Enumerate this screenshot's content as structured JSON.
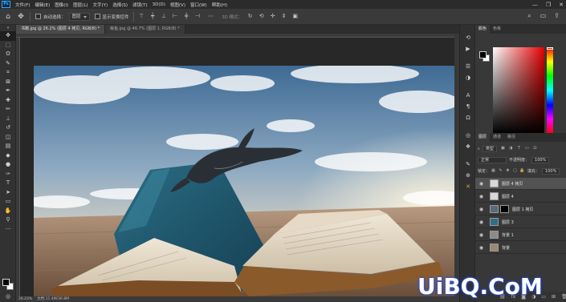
{
  "app": {
    "logo": "Ps"
  },
  "menu": [
    "文件(F)",
    "编辑(E)",
    "图像(I)",
    "图层(L)",
    "文字(Y)",
    "选择(S)",
    "滤镜(T)",
    "3D(D)",
    "视图(V)",
    "窗口(W)",
    "帮助(H)"
  ],
  "window_controls": [
    "—",
    "❐",
    "✕"
  ],
  "options": {
    "auto_select_label": "自动选择：",
    "auto_select_value": "图层",
    "transform_label": "显示变换控件",
    "mode_3d": "3D 模式："
  },
  "tabs": [
    {
      "label": "书籍.jpg @ 26.2% (图层 4 拷贝, RGB/8) *",
      "active": true
    },
    {
      "label": "鲸鱼.jpg @ 46.7% (图层 1, RGB/8) *",
      "active": false
    }
  ],
  "status": {
    "zoom": "26.23%",
    "doc": "文档:11.4M/36.8M"
  },
  "color_panel": {
    "tabs": [
      "颜色",
      "色板"
    ],
    "fg": "#000000",
    "bg": "#ffffff"
  },
  "layers_panel": {
    "tabs": [
      "图层",
      "通道",
      "路径"
    ],
    "filter_kind": "类型",
    "blend_mode": "正常",
    "opacity_label": "不透明度：",
    "opacity_value": "100%",
    "lock_label": "锁定：",
    "fill_label": "填充：",
    "fill_value": "100%",
    "layers": [
      {
        "name": "图层 4 拷贝",
        "selected": true,
        "thumb": "#d8d8d8",
        "mask": false
      },
      {
        "name": "图层 4",
        "selected": false,
        "thumb": "#d8d8d8",
        "mask": false
      },
      {
        "name": "图层 1 拷贝",
        "selected": false,
        "thumb": "#5a6a7a",
        "mask": true
      },
      {
        "name": "图层 3",
        "selected": false,
        "thumb": "#2e6f83",
        "mask": false
      },
      {
        "name": "背景 1",
        "selected": false,
        "thumb": "#8a8a8a",
        "mask": false
      },
      {
        "name": "背景",
        "selected": false,
        "thumb": "#9a8a70",
        "mask": false
      }
    ]
  },
  "watermark": "UiBQ.CoM"
}
